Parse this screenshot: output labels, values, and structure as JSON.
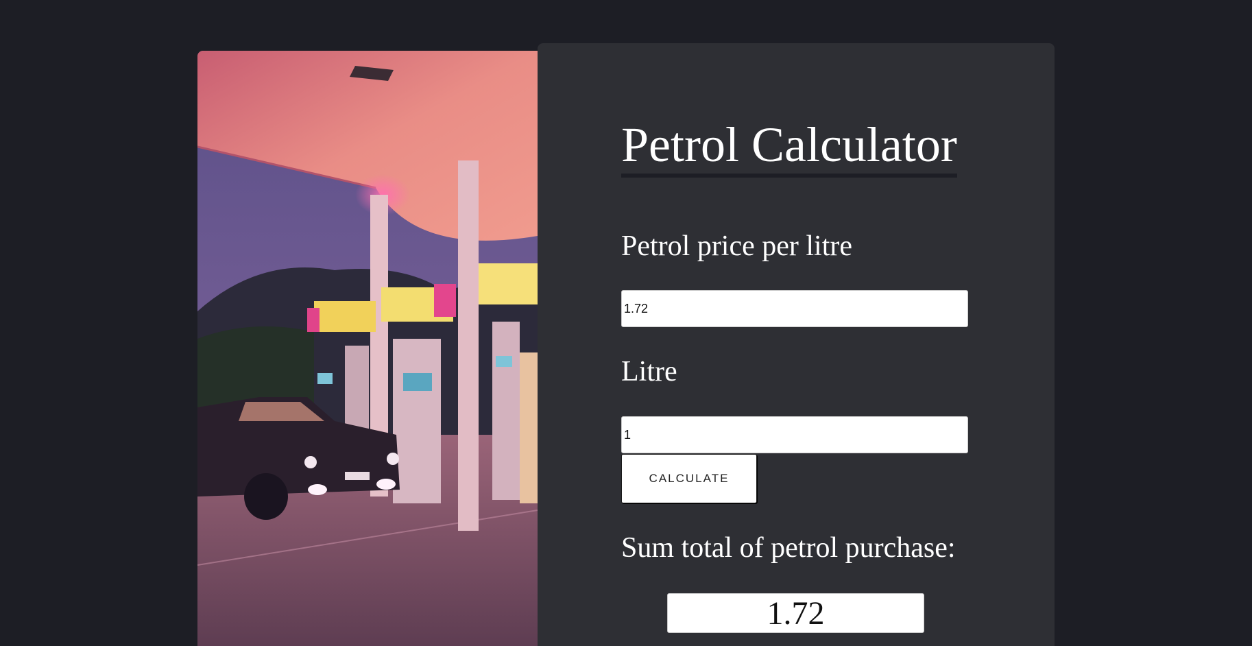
{
  "image": {
    "icon": "petrol-station-photo",
    "description_alt": "Petrol station at dusk with car under pink lit canopy"
  },
  "calculator": {
    "title": "Petrol Calculator",
    "price_label": "Petrol price per litre",
    "price_value": "1.72",
    "litre_label": "Litre",
    "litre_value": "1",
    "calculate_label": "CALCULATE",
    "result_label": "Sum total of petrol purchase:",
    "result_value": "1.72"
  },
  "colors": {
    "page_background": "#1d1e25",
    "card_background": "#2e2f34",
    "text": "#ffffff",
    "canopy_pink": "#e0777f"
  }
}
